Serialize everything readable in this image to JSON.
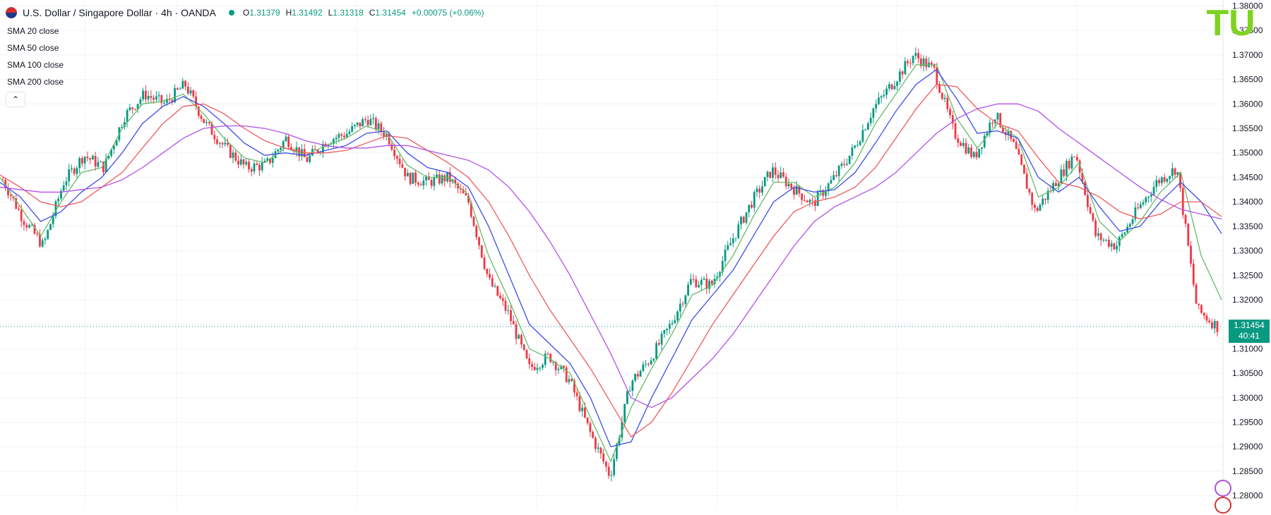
{
  "header": {
    "symbol": "U.S. Dollar / Singapore Dollar · 4h · OANDA",
    "o_label": "O",
    "o_value": "1.31379",
    "h_label": "H",
    "h_value": "1.31492",
    "l_label": "L",
    "l_value": "1.31318",
    "c_label": "C",
    "c_value": "1.31454",
    "change": "+0.00075 (+0.06%)"
  },
  "indicators": [
    "SMA 20 close",
    "SMA 50 close",
    "SMA 100 close",
    "SMA 200 close"
  ],
  "price_label": {
    "price": "1.31454",
    "countdown": "40:41"
  },
  "logo_text": "TU",
  "colors": {
    "up": "#089981",
    "down": "#f23645",
    "sma20": "#66bb6a",
    "sma50": "#3d4ee6",
    "sma100": "#f05a5a",
    "sma200": "#b451e6",
    "grid": "#f0f3fa",
    "last_price_line": "#089981",
    "logo": "#7ed321"
  },
  "chart_data": {
    "type": "line",
    "title": "U.S. Dollar / Singapore Dollar · 4h · OANDA",
    "ylim": [
      1.2775,
      1.3805
    ],
    "y_ticks": [
      "1.28000",
      "1.28500",
      "1.29000",
      "1.29500",
      "1.30000",
      "1.30500",
      "1.31000",
      "1.31500",
      "1.32000",
      "1.32500",
      "1.33000",
      "1.33500",
      "1.34000",
      "1.34500",
      "1.35000",
      "1.35500",
      "1.36000",
      "1.36500",
      "1.37000",
      "1.37500",
      "1.38000"
    ],
    "last_price": 1.31454,
    "grid": true,
    "x": [
      0,
      1,
      2,
      3,
      4,
      5,
      6,
      7,
      8,
      9,
      10,
      11,
      12,
      13,
      14,
      15,
      16,
      17,
      18,
      19,
      20,
      21,
      22,
      23,
      24,
      25,
      26,
      27,
      28,
      29,
      30,
      31,
      32,
      33,
      34,
      35,
      36,
      37,
      38,
      39,
      40,
      41,
      42,
      43,
      44,
      45,
      46,
      47,
      48,
      49,
      50,
      51,
      52,
      53,
      54,
      55,
      56,
      57,
      58,
      59,
      60
    ],
    "series": [
      {
        "name": "Close",
        "values": [
          1.3445,
          1.3365,
          1.331,
          1.344,
          1.3495,
          1.347,
          1.3575,
          1.362,
          1.36,
          1.364,
          1.356,
          1.351,
          1.347,
          1.3475,
          1.353,
          1.3485,
          1.3525,
          1.354,
          1.357,
          1.3535,
          1.345,
          1.344,
          1.345,
          1.34,
          1.324,
          1.317,
          1.306,
          1.3085,
          1.3035,
          1.293,
          1.284,
          1.303,
          1.308,
          1.315,
          1.324,
          1.323,
          1.332,
          1.34,
          1.3465,
          1.343,
          1.3395,
          1.3445,
          1.3505,
          1.359,
          1.3645,
          1.37,
          1.367,
          1.354,
          1.349,
          1.358,
          1.351,
          1.338,
          1.344,
          1.35,
          1.333,
          1.331,
          1.338,
          1.344,
          1.347,
          1.318,
          1.3145
        ]
      },
      {
        "name": "SMA 20 close",
        "values": [
          1.345,
          1.339,
          1.333,
          1.34,
          1.346,
          1.347,
          1.355,
          1.36,
          1.3605,
          1.362,
          1.358,
          1.353,
          1.349,
          1.348,
          1.351,
          1.3495,
          1.3515,
          1.353,
          1.3555,
          1.354,
          1.3475,
          1.345,
          1.345,
          1.3415,
          1.329,
          1.32,
          1.31,
          1.308,
          1.305,
          1.296,
          1.287,
          1.298,
          1.306,
          1.313,
          1.321,
          1.323,
          1.329,
          1.337,
          1.344,
          1.344,
          1.341,
          1.343,
          1.348,
          1.356,
          1.362,
          1.368,
          1.368,
          1.357,
          1.351,
          1.356,
          1.353,
          1.341,
          1.343,
          1.348,
          1.336,
          1.332,
          1.336,
          1.342,
          1.346,
          1.329,
          1.32
        ]
      },
      {
        "name": "SMA 50 close",
        "values": [
          1.344,
          1.341,
          1.336,
          1.338,
          1.342,
          1.345,
          1.35,
          1.356,
          1.3595,
          1.3615,
          1.3595,
          1.356,
          1.352,
          1.3495,
          1.35,
          1.3495,
          1.3505,
          1.3515,
          1.354,
          1.3545,
          1.35,
          1.347,
          1.346,
          1.343,
          1.335,
          1.325,
          1.315,
          1.311,
          1.307,
          1.3,
          1.29,
          1.291,
          1.3,
          1.308,
          1.316,
          1.321,
          1.326,
          1.333,
          1.34,
          1.343,
          1.342,
          1.3425,
          1.346,
          1.352,
          1.3585,
          1.364,
          1.367,
          1.361,
          1.354,
          1.3545,
          1.353,
          1.345,
          1.342,
          1.345,
          1.339,
          1.334,
          1.335,
          1.34,
          1.344,
          1.34,
          1.3335
        ]
      },
      {
        "name": "SMA 100 close",
        "values": [
          1.3455,
          1.343,
          1.34,
          1.339,
          1.34,
          1.343,
          1.346,
          1.351,
          1.356,
          1.3595,
          1.36,
          1.358,
          1.355,
          1.3525,
          1.351,
          1.35,
          1.35,
          1.3505,
          1.352,
          1.3535,
          1.353,
          1.3505,
          1.348,
          1.345,
          1.34,
          1.333,
          1.325,
          1.318,
          1.312,
          1.306,
          1.299,
          1.292,
          1.295,
          1.301,
          1.308,
          1.315,
          1.321,
          1.327,
          1.333,
          1.338,
          1.34,
          1.341,
          1.343,
          1.347,
          1.353,
          1.359,
          1.364,
          1.3635,
          1.359,
          1.356,
          1.3545,
          1.349,
          1.344,
          1.343,
          1.341,
          1.338,
          1.3365,
          1.3375,
          1.34,
          1.34,
          1.337
        ]
      },
      {
        "name": "SMA 200 close",
        "values": [
          1.343,
          1.3425,
          1.342,
          1.342,
          1.3425,
          1.343,
          1.3445,
          1.347,
          1.35,
          1.353,
          1.355,
          1.3555,
          1.3555,
          1.355,
          1.354,
          1.3525,
          1.3515,
          1.351,
          1.351,
          1.3515,
          1.3515,
          1.3505,
          1.3495,
          1.3485,
          1.3465,
          1.343,
          1.338,
          1.332,
          1.325,
          1.317,
          1.309,
          1.3,
          1.298,
          1.3,
          1.304,
          1.308,
          1.313,
          1.319,
          1.325,
          1.331,
          1.336,
          1.339,
          1.341,
          1.343,
          1.346,
          1.35,
          1.354,
          1.357,
          1.359,
          1.36,
          1.36,
          1.3585,
          1.355,
          1.352,
          1.349,
          1.346,
          1.343,
          1.3405,
          1.3385,
          1.3375,
          1.3365
        ]
      }
    ]
  }
}
